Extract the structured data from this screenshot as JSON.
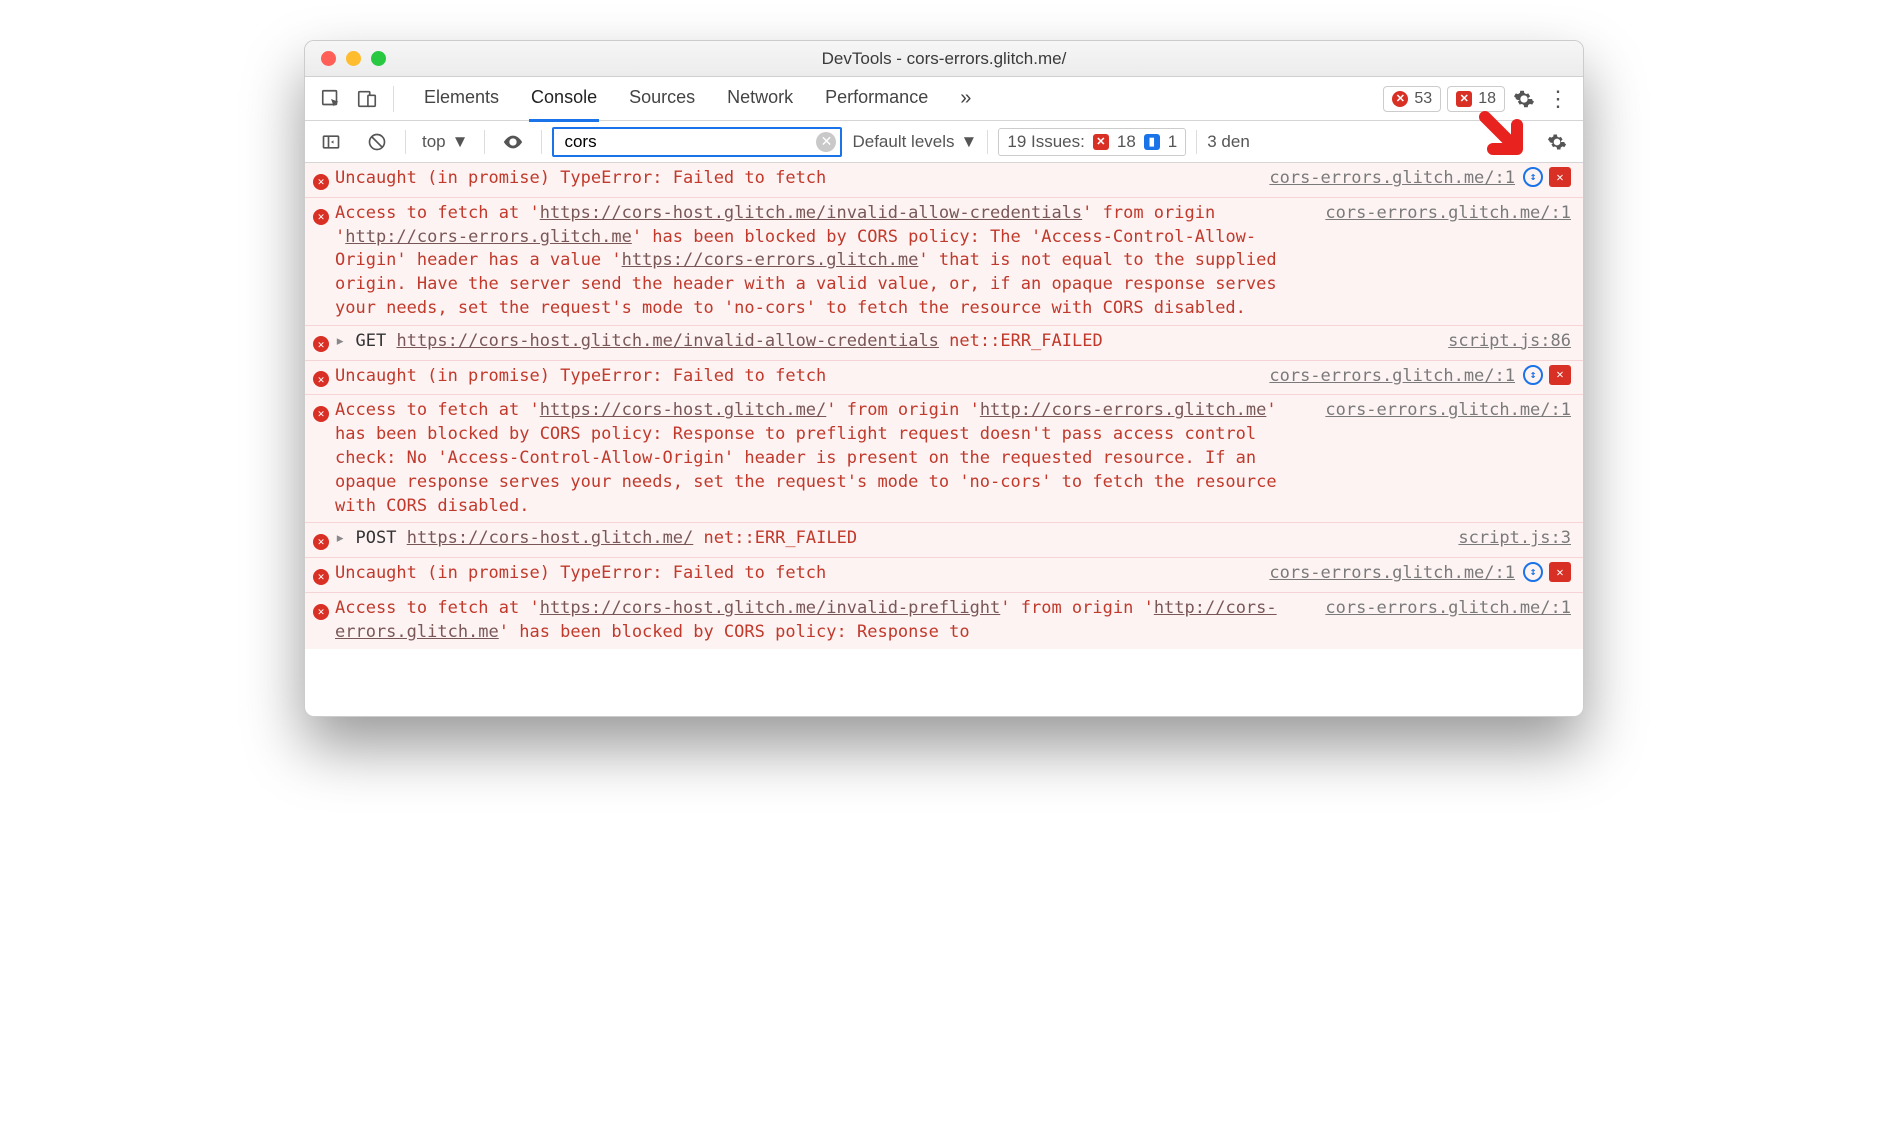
{
  "window": {
    "title": "DevTools - cors-errors.glitch.me/"
  },
  "tabs": {
    "items": [
      {
        "label": "Elements",
        "active": false
      },
      {
        "label": "Console",
        "active": true
      },
      {
        "label": "Sources",
        "active": false
      },
      {
        "label": "Network",
        "active": false
      },
      {
        "label": "Performance",
        "active": false
      }
    ],
    "overflow": "»"
  },
  "counters": {
    "errors": "53",
    "cors_errors": "18"
  },
  "filter": {
    "context": "top",
    "value": "cors",
    "levels": "Default levels",
    "issues_label": "19 Issues:",
    "issues_errors": "18",
    "issues_info": "1",
    "hidden_text": "3     den"
  },
  "src1": "cors-errors.glitch.me/:1",
  "msgs": [
    {
      "type": "uncaught",
      "text": "Uncaught (in promise) TypeError: Failed to fetch",
      "source": "cors-errors.glitch.me/:1",
      "trail": true
    },
    {
      "type": "cors",
      "source": "cors-errors.glitch.me/:1",
      "p1": "Access to fetch at '",
      "u1": "https://cors-host.glitch.me/invalid-allow-credentials",
      "p2": "' from origin '",
      "u2": "http://cors-errors.glitch.me",
      "p3": "' has been blocked by CORS policy: The 'Access-Control-Allow-Origin' header has a value '",
      "u3": "https://cors-errors.glitch.me",
      "p4": "' that is not equal to the supplied origin. Have the server send the header with a valid value, or, if an opaque response serves your needs, set the request's mode to 'no-cors' to fetch the resource with CORS disabled."
    },
    {
      "type": "net",
      "method": "GET",
      "url": "https://cors-host.glitch.me/invalid-allow-credentials",
      "status": "net::ERR_FAILED",
      "source": "script.js:86"
    },
    {
      "type": "uncaught",
      "text": "Uncaught (in promise) TypeError: Failed to fetch",
      "source": "cors-errors.glitch.me/:1",
      "trail": true
    },
    {
      "type": "cors",
      "source": "cors-errors.glitch.me/:1",
      "p1": "Access to fetch at '",
      "u1": "https://cors-host.glitch.me/",
      "p2": "' from origin '",
      "u2": "http://cors-errors.glitch.me",
      "p3": "' has been blocked by CORS policy: Response to preflight request doesn't pass access control check: No 'Access-Control-Allow-Origin' header is present on the requested resource. If an opaque response serves your needs, set the request's mode to 'no-cors' to fetch the resource with CORS disabled."
    },
    {
      "type": "net",
      "method": "POST",
      "url": "https://cors-host.glitch.me/",
      "status": "net::ERR_FAILED",
      "source": "script.js:3"
    },
    {
      "type": "uncaught",
      "text": "Uncaught (in promise) TypeError: Failed to fetch",
      "source": "cors-errors.glitch.me/:1",
      "trail": true
    },
    {
      "type": "cors",
      "source": "cors-errors.glitch.me/:1",
      "p1": "Access to fetch at '",
      "u1": "https://cors-host.glitch.me/invalid-preflight",
      "p2": "' from origin '",
      "u2": "http://cors-errors.glitch.me",
      "p3": "' has been blocked by CORS policy: Response to"
    }
  ]
}
